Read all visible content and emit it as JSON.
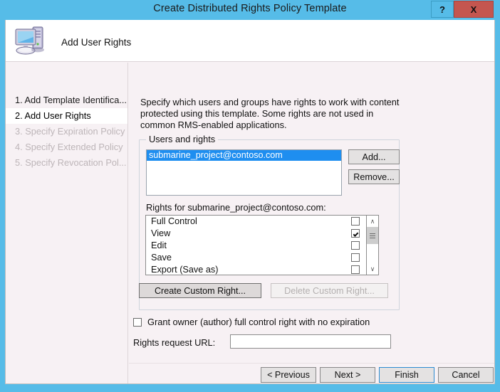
{
  "window": {
    "title": "Create Distributed Rights Policy Template",
    "help_label": "?",
    "close_label": "X",
    "accent_color": "#56bce8",
    "close_color": "#c4564f"
  },
  "header": {
    "title": "Add User Rights",
    "icon": "computer-icon"
  },
  "sidebar": {
    "steps": [
      {
        "label": "1. Add Template Identifica...",
        "state": "done"
      },
      {
        "label": "2. Add User Rights",
        "state": "current"
      },
      {
        "label": "3. Specify Expiration Policy",
        "state": "disabled"
      },
      {
        "label": "4. Specify Extended Policy",
        "state": "disabled"
      },
      {
        "label": "5. Specify Revocation Pol...",
        "state": "disabled"
      }
    ]
  },
  "main": {
    "intro": "Specify which users and groups have rights to work with content protected using this template. Some rights are not used in common RMS-enabled applications.",
    "group_legend": "Users and rights",
    "users": [
      {
        "name": "submarine_project@contoso.com",
        "selected": true
      }
    ],
    "add_label": "Add...",
    "remove_label": "Remove...",
    "rights_label": "Rights for submarine_project@contoso.com:",
    "rights": [
      {
        "label": "Full Control",
        "checked": false
      },
      {
        "label": "View",
        "checked": true
      },
      {
        "label": "Edit",
        "checked": false
      },
      {
        "label": "Save",
        "checked": false
      },
      {
        "label": "Export (Save as)",
        "checked": false
      }
    ],
    "create_custom_label": "Create Custom Right...",
    "delete_custom_label": "Delete Custom Right...",
    "delete_custom_disabled": true,
    "grant_owner_label": "Grant owner (author) full control right with no expiration",
    "grant_owner_checked": false,
    "url_label": "Rights request URL:",
    "url_value": "",
    "scrollbar": {
      "up": "∧",
      "down": "∨"
    }
  },
  "footer": {
    "previous_label": "< Previous",
    "next_label": "Next >",
    "finish_label": "Finish",
    "cancel_label": "Cancel"
  }
}
